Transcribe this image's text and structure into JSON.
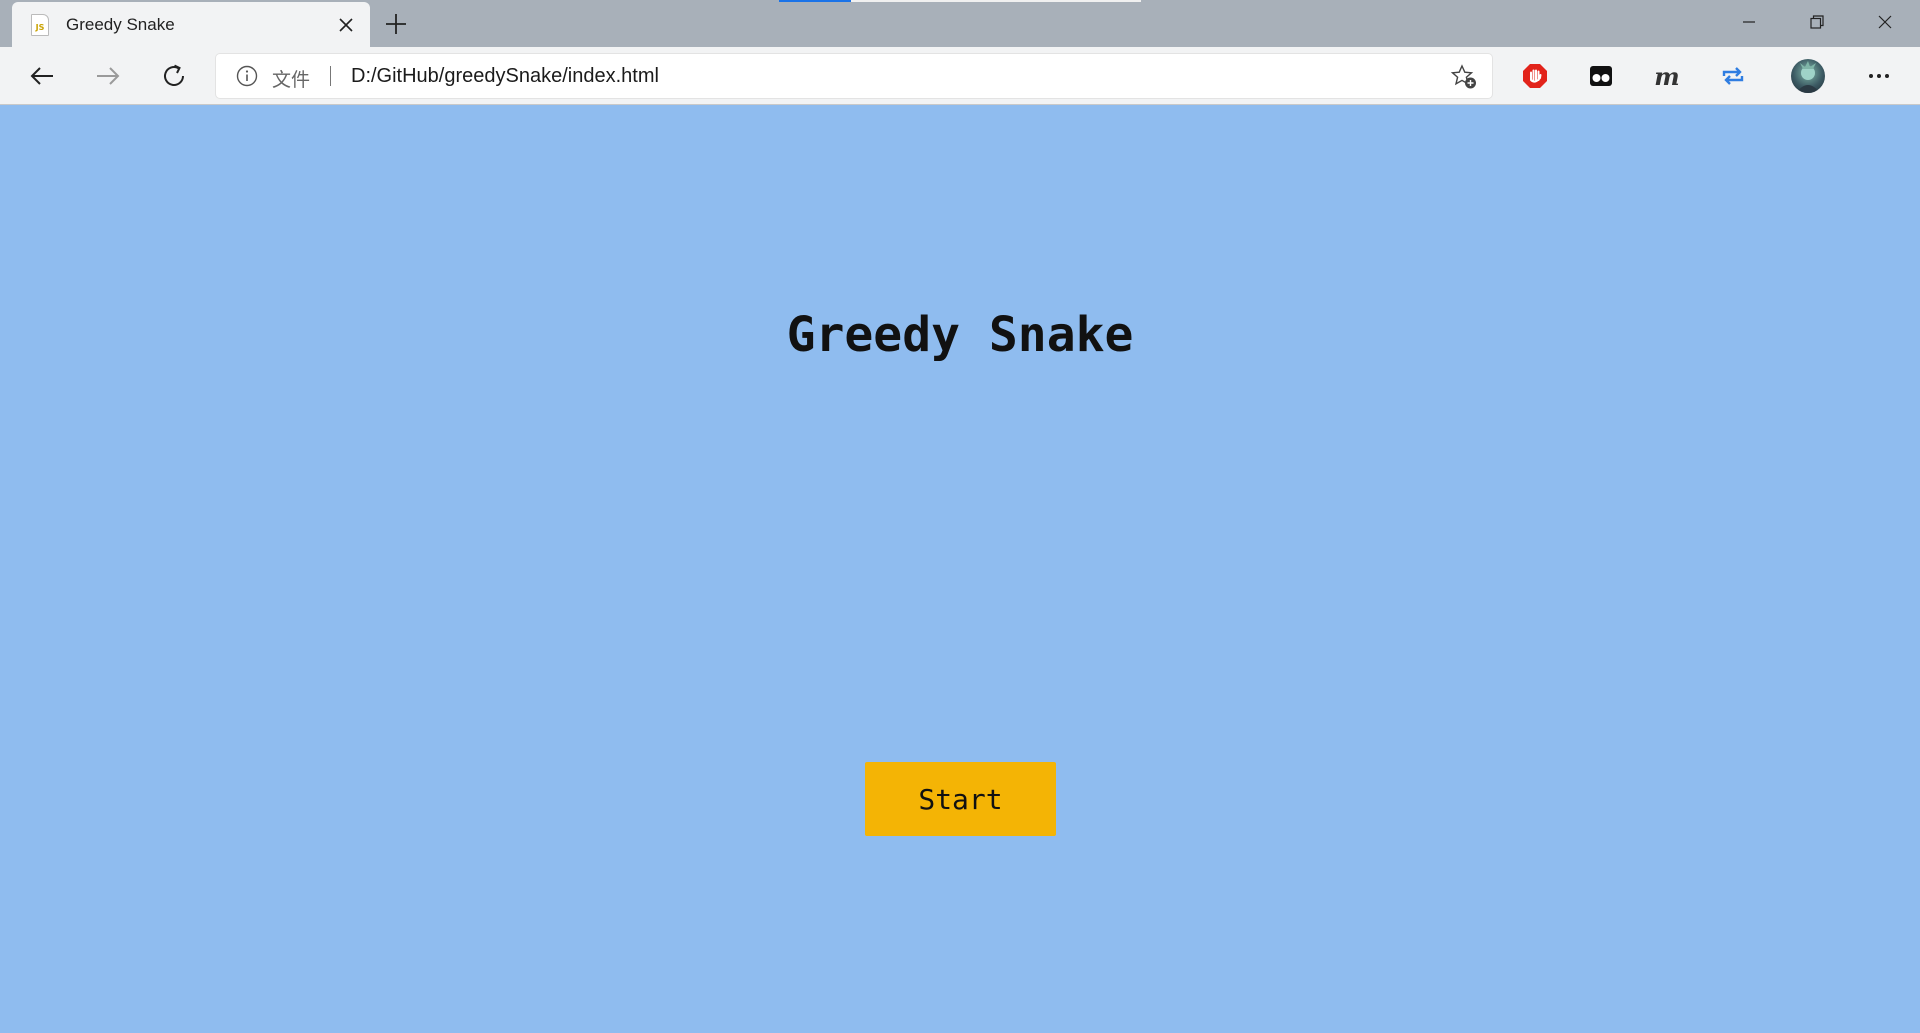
{
  "browser": {
    "tab": {
      "title": "Greedy Snake",
      "favicon_text": "JS",
      "favicon": "js-file-icon"
    },
    "new_tab": "plus-icon",
    "window_controls": [
      "minimize-icon",
      "restore-icon",
      "close-icon"
    ],
    "toolbar": {
      "back": "arrow-left-icon",
      "forward": "arrow-right-icon",
      "reload": "reload-icon"
    },
    "address_bar": {
      "info_icon": "info-icon",
      "scheme_label": "文件",
      "url": "D:/GitHub/greedySnake/index.html",
      "favorite_icon": "star-plus-icon"
    },
    "extensions": [
      "adblock-icon",
      "glasses-icon",
      "m-icon",
      "sync-icon"
    ],
    "extension_m_label": "m",
    "profile": "avatar",
    "more": "more-icon"
  },
  "page": {
    "title": "Greedy Snake",
    "start_button": "Start"
  },
  "colors": {
    "page_background": "#8fbcef",
    "button_background": "#f4b405",
    "chrome_background": "#f2f3f4",
    "titlebar_background": "#a8b0b9"
  }
}
